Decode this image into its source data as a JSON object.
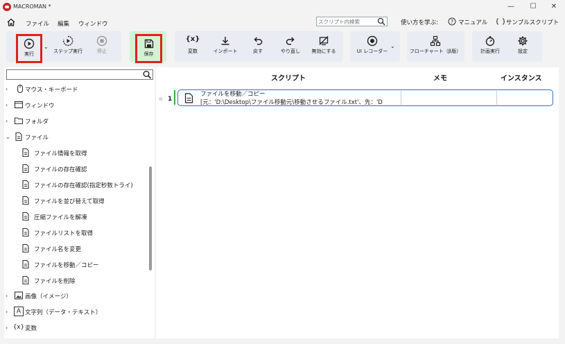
{
  "window": {
    "title": "MACROMAN *",
    "minimize": "—",
    "maximize": "☐",
    "close": "✕"
  },
  "menu": {
    "items": [
      "ファイル",
      "編集",
      "ウィンドウ"
    ],
    "search_placeholder": "スクリプト内検索",
    "help": {
      "learn": "使い方を学ぶ:",
      "manual": "マニュアル",
      "samples": "サンプルスクリプト"
    }
  },
  "toolbar": {
    "run": "実行",
    "step_run": "ステップ実行",
    "stop": "停止",
    "save": "保存",
    "variables": "変数",
    "import": "インポート",
    "undo": "戻す",
    "redo": "やり直し",
    "disable": "無効にする",
    "ui_recorder": "UI レコーダー",
    "flowchart": "フローチャート（β版）",
    "schedule": "計画実行",
    "settings": "設定",
    "variables_glyph": "{x}"
  },
  "tree": {
    "search_value": "",
    "categories": [
      {
        "label": "マウス・キーボード",
        "expanded": false,
        "icon": "mouse-icon"
      },
      {
        "label": "ウィンドウ",
        "expanded": false,
        "icon": "window-icon"
      },
      {
        "label": "フォルダ",
        "expanded": false,
        "icon": "folder-icon"
      },
      {
        "label": "ファイル",
        "expanded": true,
        "icon": "file-icon"
      }
    ],
    "file_items": [
      "ファイル情報を取得",
      "ファイルの存在確認",
      "ファイルの存在確認(指定秒数トライ)",
      "ファイルを並び替えて取得",
      "圧縮ファイルを解凍",
      "ファイルリストを取得",
      "ファイル名を変更",
      "ファイルを移動／コピー",
      "ファイルを削除"
    ],
    "more_categories": [
      {
        "label": "画像（イメージ）",
        "icon": "image-icon"
      },
      {
        "label": "文字列（データ・テキスト）",
        "icon": "text-icon",
        "glyph": "A"
      },
      {
        "label": "変数",
        "icon": "variable-icon",
        "glyph": "{x}"
      }
    ]
  },
  "script": {
    "columns": {
      "script": "スクリプト",
      "memo": "メモ",
      "instance": "インスタンス"
    },
    "rows": [
      {
        "number": "1",
        "title": "ファイルを移動／コピー",
        "detail": "[元：'D:\\Desktop\\ファイル移動元\\移動させるファイル.txt'、先：'D"
      }
    ]
  },
  "colors": {
    "highlight_box": "#e0201c",
    "save_bg": "#d6f0d6",
    "selected_row_border": "#2b6fd6",
    "row_marker": "#3aa84a"
  }
}
